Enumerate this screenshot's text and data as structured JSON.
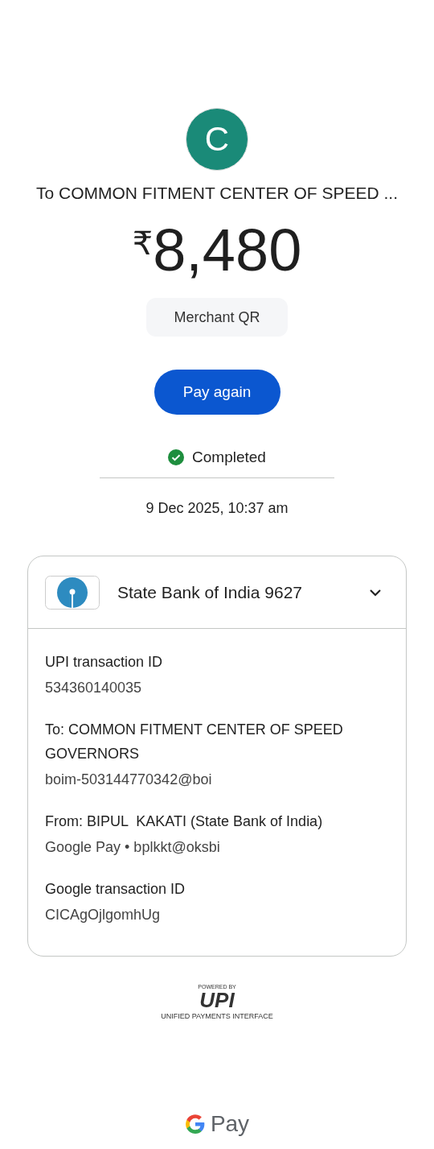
{
  "payee": {
    "initial": "C",
    "color": "#1a8a78",
    "title": "To COMMON FITMENT CENTER OF SPEED ..."
  },
  "amount": {
    "currency": "₹",
    "value": "8,480"
  },
  "source_chip": "Merchant QR",
  "pay_again_button": "Pay again",
  "status": {
    "kind": "success",
    "text": "Completed"
  },
  "date": "9 Dec 2025, 10:37 am",
  "account_card": {
    "bank": "State Bank of India 9627",
    "expanded": false,
    "details": [
      {
        "label": "UPI transaction ID",
        "value": "534360140035"
      },
      {
        "label": "To: COMMON FITMENT CENTER OF SPEED GOVERNORS",
        "value": "boim-503144770342@boi"
      },
      {
        "label": "From: BIPUL  KAKATI (State Bank of India)",
        "value": "Google Pay • bplkkt@oksbi"
      },
      {
        "label": "Google transaction ID",
        "value": "CICAgOjlgomhUg"
      }
    ]
  },
  "upi_badge": {
    "top": "POWERED BY",
    "logo": "UPI",
    "bottom": "UNIFIED PAYMENTS INTERFACE"
  },
  "footer_brand": "Pay"
}
